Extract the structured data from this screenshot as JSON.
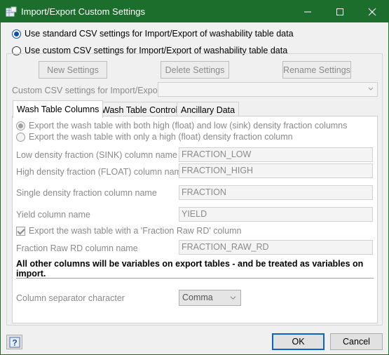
{
  "window": {
    "title": "Import/Export Custom Settings",
    "icon": "table-export-icon"
  },
  "mode": {
    "standard_label": "Use standard CSV settings for Import/Export of washability table data",
    "custom_label": "Use custom CSV settings for Import/Export of washability table data",
    "selected": "standard"
  },
  "settings_buttons": {
    "new": "New Settings",
    "delete": "Delete Settings",
    "rename": "Rename Settings"
  },
  "custom_settings": {
    "label": "Custom CSV settings for Import/Export",
    "value": ""
  },
  "tabs": [
    {
      "label": "Wash Table Columns",
      "active": true
    },
    {
      "label": "Wash Table Control",
      "active": false
    },
    {
      "label": "Ancillary Data",
      "active": false
    }
  ],
  "wash_table": {
    "export_both_label": "Export the wash table with both high (float) and low (sink) density fraction columns",
    "export_single_label": "Export the wash table with only a high (float) density fraction column",
    "export_selected": "both",
    "low_label": "Low density fraction (SINK) column name",
    "low_value": "FRACTION_LOW",
    "high_label": "High density fraction (FLOAT) column name",
    "high_value": "FRACTION_HIGH",
    "single_label": "Single density fraction column name",
    "single_value": "FRACTION",
    "yield_label": "Yield column name",
    "yield_value": "YIELD",
    "raw_rd_check_label": "Export the wash table with a 'Fraction Raw RD' column",
    "raw_rd_checked": true,
    "raw_rd_label": "Fraction Raw RD column name",
    "raw_rd_value": "FRACTION_RAW_RD",
    "note": "All other columns will be variables on export tables - and be treated as variables on import.",
    "separator_label": "Column separator character",
    "separator_value": "Comma"
  },
  "footer": {
    "help_icon": "help-icon",
    "ok": "OK",
    "cancel": "Cancel"
  },
  "colors": {
    "titlebar": "#1b6e2c",
    "accent": "#0a4fa8"
  }
}
